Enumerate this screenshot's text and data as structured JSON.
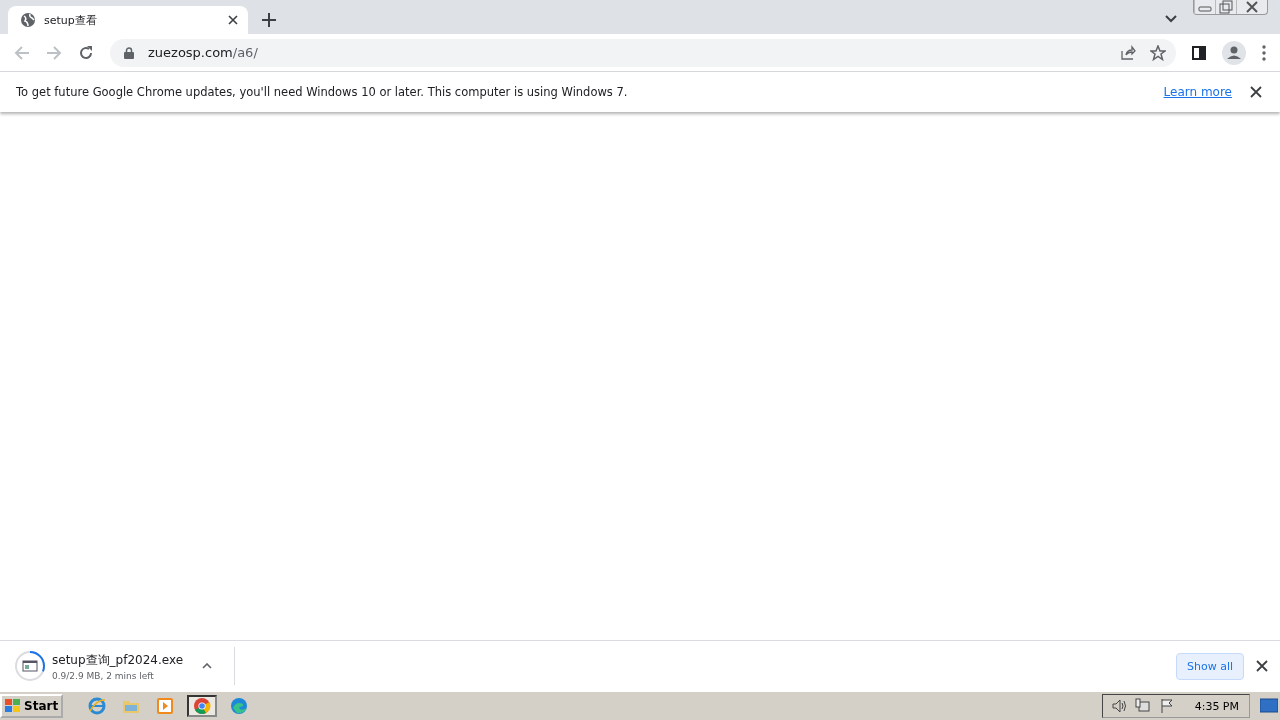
{
  "tabs": [
    {
      "title": "setup查看",
      "selected": true
    }
  ],
  "address": {
    "host": "zuezosp.com",
    "path": "/a6/"
  },
  "infobar": {
    "message": "To get future Google Chrome updates, you'll need Windows 10 or later. This computer is using Windows 7.",
    "link": "Learn more"
  },
  "download": {
    "filename": "setup查询_pf2024.exe",
    "status": "0.9/2.9 MB, 2 mins left",
    "level": 0.31
  },
  "show_all": "Show all",
  "taskbar": {
    "start": "Start",
    "apps": [
      {
        "kind": "ie",
        "selected": false
      },
      {
        "kind": "folder",
        "selected": false
      },
      {
        "kind": "media",
        "selected": false
      },
      {
        "kind": "chrome",
        "selected": true
      },
      {
        "kind": "edge",
        "selected": false
      }
    ],
    "clock": "4:35 PM"
  }
}
